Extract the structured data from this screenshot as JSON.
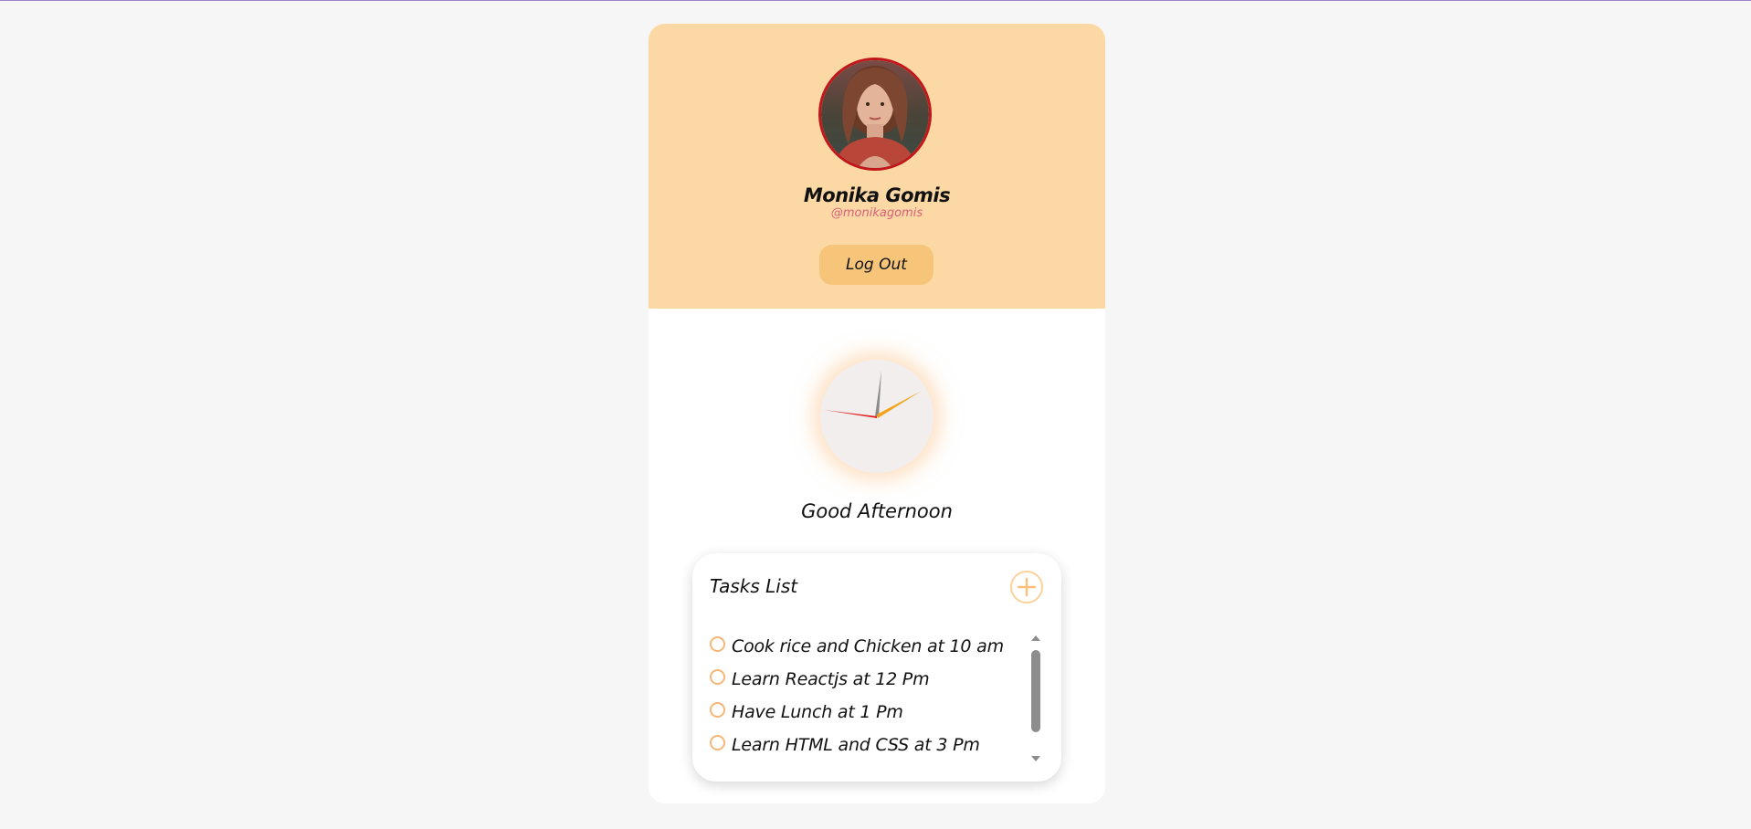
{
  "profile": {
    "name": "Monika Gomis",
    "handle": "@monikagomis",
    "logout_label": "Log Out",
    "avatar_icon": "user-photo"
  },
  "clock": {
    "hour_hand_color": "#f2a317",
    "minute_hand_color": "#8a8a8a",
    "second_hand_color": "#e02020"
  },
  "greeting": "Good Afternoon",
  "tasks": {
    "title": "Tasks List",
    "add_icon": "plus-icon",
    "items": [
      {
        "label": "Cook rice and Chicken at 10 am"
      },
      {
        "label": "Learn Reactjs at 12 Pm"
      },
      {
        "label": "Have Lunch at 1 Pm"
      },
      {
        "label": "Learn HTML and CSS at 3 Pm"
      },
      {
        "label": ""
      }
    ]
  },
  "colors": {
    "profile_bg": "#fcd8a5",
    "logout_bg": "#f6c57a",
    "accent": "#f6b67a",
    "handle": "#d8607a"
  }
}
